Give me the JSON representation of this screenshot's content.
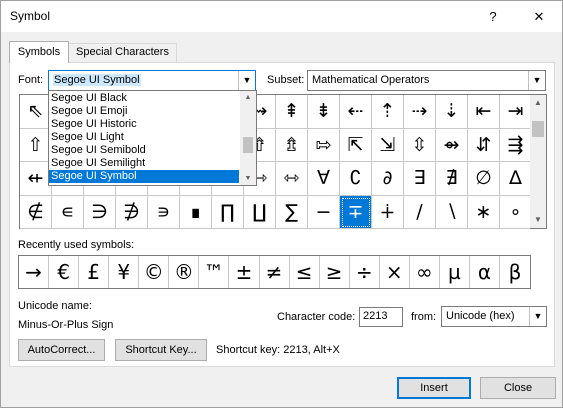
{
  "window": {
    "title": "Symbol",
    "help": "?",
    "close": "✕"
  },
  "tabs": [
    {
      "label": "Symbols"
    },
    {
      "label": "Special Characters"
    }
  ],
  "font": {
    "label": "Font:",
    "value": "Segoe UI Symbol"
  },
  "subset": {
    "label": "Subset:",
    "value": "Mathematical Operators"
  },
  "font_dropdown": {
    "items": [
      "Segoe UI Black",
      "Segoe UI Emoji",
      "Segoe UI Historic",
      "Segoe UI Light",
      "Segoe UI Semibold",
      "Segoe UI Semilight",
      "Segoe UI Symbol"
    ],
    "selected": "Segoe UI Symbol"
  },
  "grid": {
    "rows": [
      [
        "⇖",
        "⇗",
        "⇘",
        "⇙",
        "⇚",
        "⇛",
        "⇜",
        "⇝",
        "⇞",
        "⇟",
        "⇠",
        "⇡",
        "⇢",
        "⇣",
        "⇤",
        "⇥"
      ],
      [
        "⇧",
        "⇨",
        "⇩",
        "⇪",
        "⇫",
        "⇬",
        "⇭",
        "⇮",
        "⇯",
        "⇰",
        "⇱",
        "⇲",
        "⇳",
        "⇴",
        "⇵",
        "⇶"
      ],
      [
        "⇷",
        "⇸",
        "⇹",
        "⇺",
        "⇻",
        "⇼",
        "⇽",
        "⇾",
        "⇿",
        "∀",
        "∁",
        "∂",
        "∃",
        "∄",
        "∅",
        "∆"
      ],
      [
        "∉",
        "∊",
        "∋",
        "∌",
        "∍",
        "∎",
        "∏",
        "∐",
        "∑",
        "−",
        "∓",
        "∔",
        "∕",
        "∖",
        "∗",
        "∘"
      ]
    ],
    "selected": "∓"
  },
  "recent": {
    "label": "Recently used symbols:",
    "symbols": [
      "→",
      "€",
      "£",
      "¥",
      "©",
      "®",
      "™",
      "±",
      "≠",
      "≤",
      "≥",
      "÷",
      "×",
      "∞",
      "µ",
      "α",
      "β"
    ]
  },
  "unicode": {
    "label": "Unicode name:",
    "value": "Minus-Or-Plus Sign"
  },
  "char_code": {
    "label": "Character code:",
    "value": "2213"
  },
  "from": {
    "label": "from:",
    "value": "Unicode (hex)"
  },
  "buttons": {
    "autocorrect": "AutoCorrect...",
    "shortcut_key": "Shortcut Key...",
    "insert": "Insert",
    "close": "Close"
  },
  "shortcut_text": "Shortcut key: 2213, Alt+X"
}
